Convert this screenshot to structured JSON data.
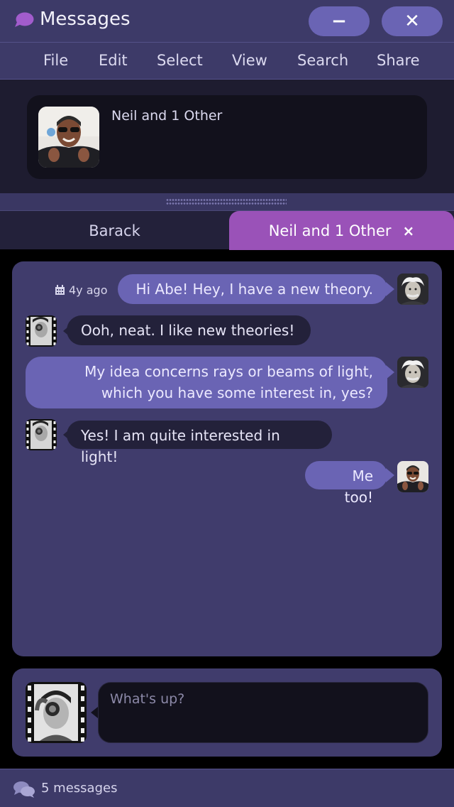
{
  "window": {
    "title": "Messages",
    "minimize_label": "−",
    "close_label": "✕",
    "icon": "chat-bubble-icon"
  },
  "menu": {
    "items": [
      "File",
      "Edit",
      "Select",
      "View",
      "Search",
      "Share"
    ]
  },
  "conversations": [
    {
      "name": "Neil and 1 Other",
      "avatar": "neil-avatar"
    }
  ],
  "tabs": [
    {
      "label": "Barack",
      "active": false
    },
    {
      "label": "Neil and 1 Other",
      "active": true,
      "close_label": "×"
    }
  ],
  "chat": {
    "messages": [
      {
        "direction": "outgoing",
        "text": "Hi Abe!   Hey, I have a new theory.",
        "timestamp": "4y ago",
        "avatar": "einstein-avatar"
      },
      {
        "direction": "incoming",
        "text": "Ooh, neat.   I like new theories!",
        "avatar": "abe-avatar"
      },
      {
        "direction": "outgoing",
        "text": "My idea concerns rays or beams of light, which you have some interest in, yes?",
        "avatar": "einstein-avatar"
      },
      {
        "direction": "incoming",
        "text": "Yes!  I am quite interested in light!",
        "avatar": "abe-avatar"
      },
      {
        "direction": "outgoing",
        "text": "Me too!",
        "avatar": "neil-avatar"
      }
    ]
  },
  "composer": {
    "placeholder": "What's up?",
    "value": ""
  },
  "status": {
    "text": "5 messages",
    "icon": "chat-bubbles-icon"
  },
  "colors": {
    "accent": "#6a64b4",
    "active_tab": "#9a52b8",
    "chrome": "#3d3a68",
    "chat_bg": "#403c6c",
    "incoming_bubble": "#23213a"
  }
}
